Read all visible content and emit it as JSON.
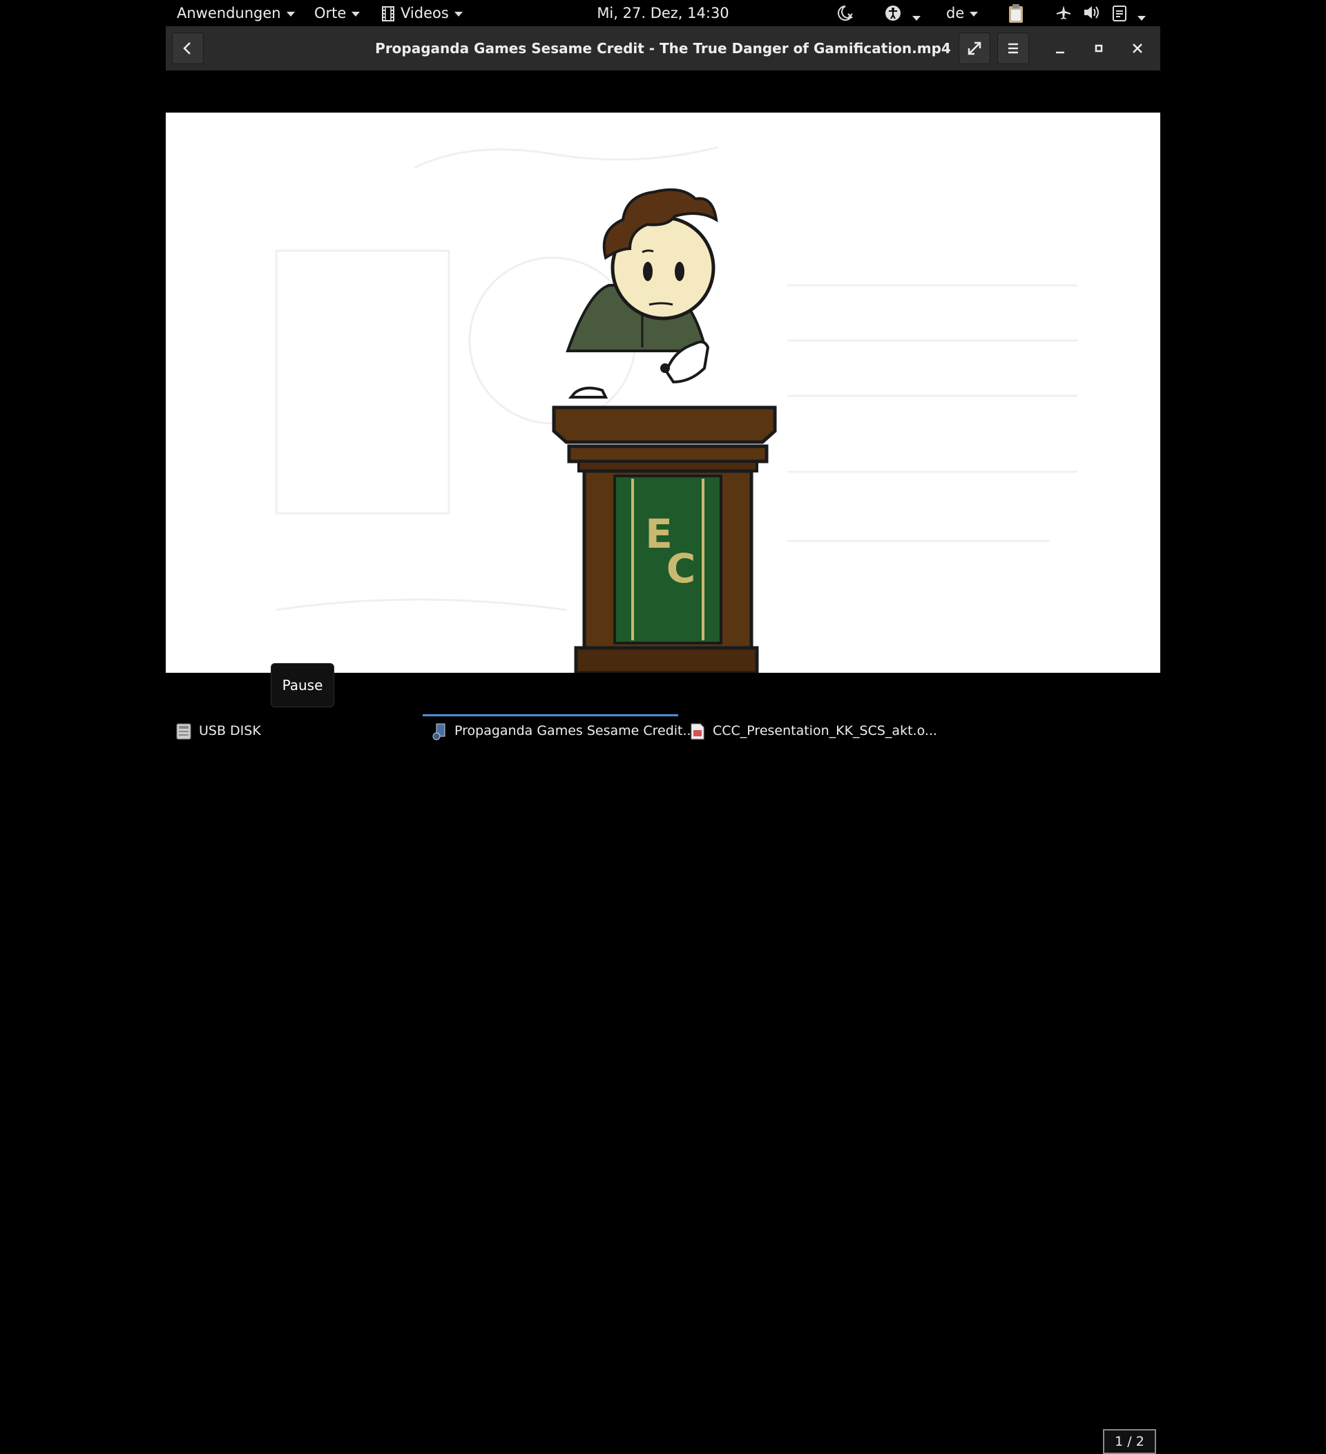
{
  "topbar": {
    "applications": "Anwendungen",
    "places": "Orte",
    "videos": "Videos",
    "clock": "Mi, 27. Dez, 14:30",
    "keyboard_layout": "de",
    "icons": [
      "night-light-icon",
      "accessibility-icon",
      "clipboard-icon",
      "airplane-icon",
      "volume-icon",
      "power-menu-icon"
    ]
  },
  "window": {
    "title": "Propaganda Games Sesame Credit - The True Danger of Gamification.mp4",
    "buttons": [
      "back-icon",
      "fullscreen-icon",
      "menu-icon",
      "minimize-icon",
      "maximize-icon",
      "close-icon"
    ]
  },
  "video": {
    "podium_letters": [
      "E",
      "C"
    ]
  },
  "tooltip": {
    "text": "Pause"
  },
  "taskbar": {
    "items": [
      {
        "label": "USB DISK",
        "icon": "disk-icon"
      },
      {
        "label": "Propaganda Games Sesame Credit...",
        "icon": "video-player-icon"
      },
      {
        "label": "CCC_Presentation_KK_SCS_akt.o...",
        "icon": "presentation-icon"
      }
    ],
    "workspace": "1 / 2"
  },
  "colors": {
    "header": "#2b2b2b",
    "accent": "#4a90d9",
    "podium_wood": "#5a3512",
    "podium_panel": "#1f5a2a",
    "podium_text": "#c9b870"
  }
}
